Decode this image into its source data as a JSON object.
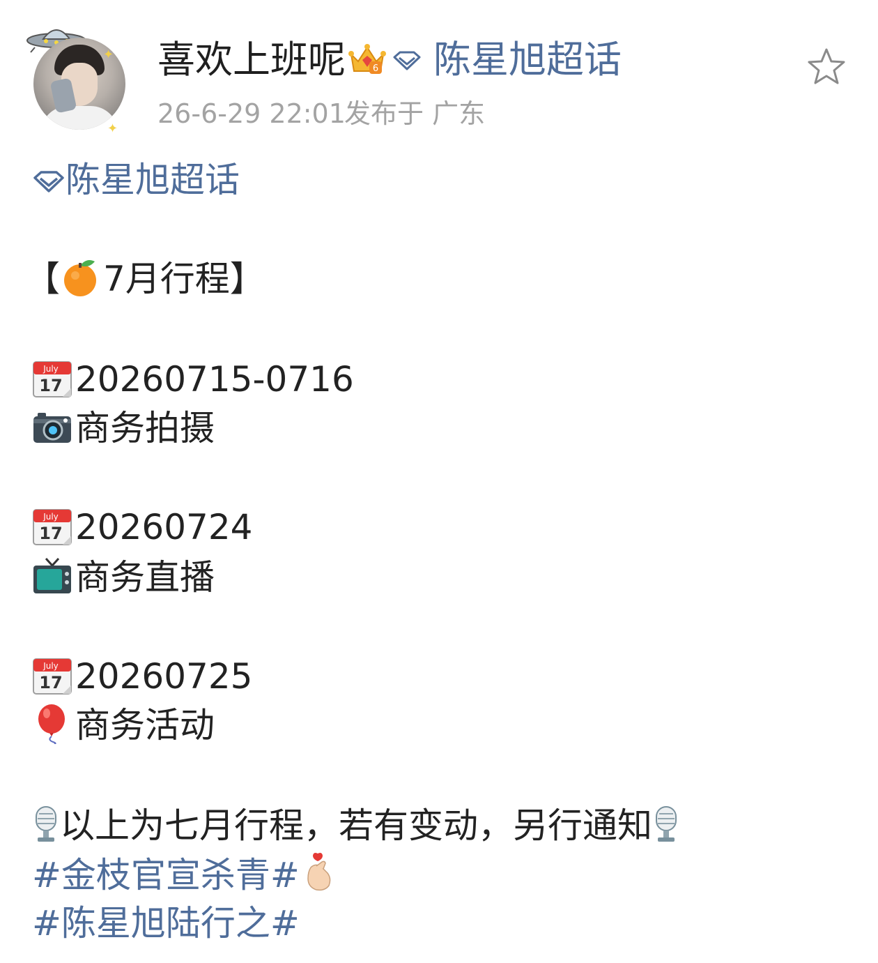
{
  "post": {
    "author": {
      "name": "喜欢上班呢",
      "level_badge": "6"
    },
    "topic_link": "陈星旭超话",
    "meta": {
      "time": "26-6-29 22:01",
      "location": "发布于 广东"
    },
    "calendar_label": "July",
    "calendar_day": "17",
    "content": {
      "topic_line": "陈星旭超话",
      "bracket_open": "【",
      "heading": "7月行程】",
      "schedule": [
        {
          "date": "20260715-0716",
          "icon": "camera-icon",
          "activity": "商务拍摄"
        },
        {
          "date": "20260724",
          "icon": "television-icon",
          "activity": "商务直播"
        },
        {
          "date": "20260725",
          "icon": "balloon-icon",
          "activity": "商务活动"
        }
      ],
      "notice": "以上为七月行程，若有变动，另行通知",
      "hashtags": [
        "#金枝官宣杀青#",
        "#陈星旭陆行之#"
      ]
    }
  },
  "colors": {
    "link": "#4f6d9a",
    "meta": "#a3a3a3",
    "text": "#1f1f1f"
  }
}
